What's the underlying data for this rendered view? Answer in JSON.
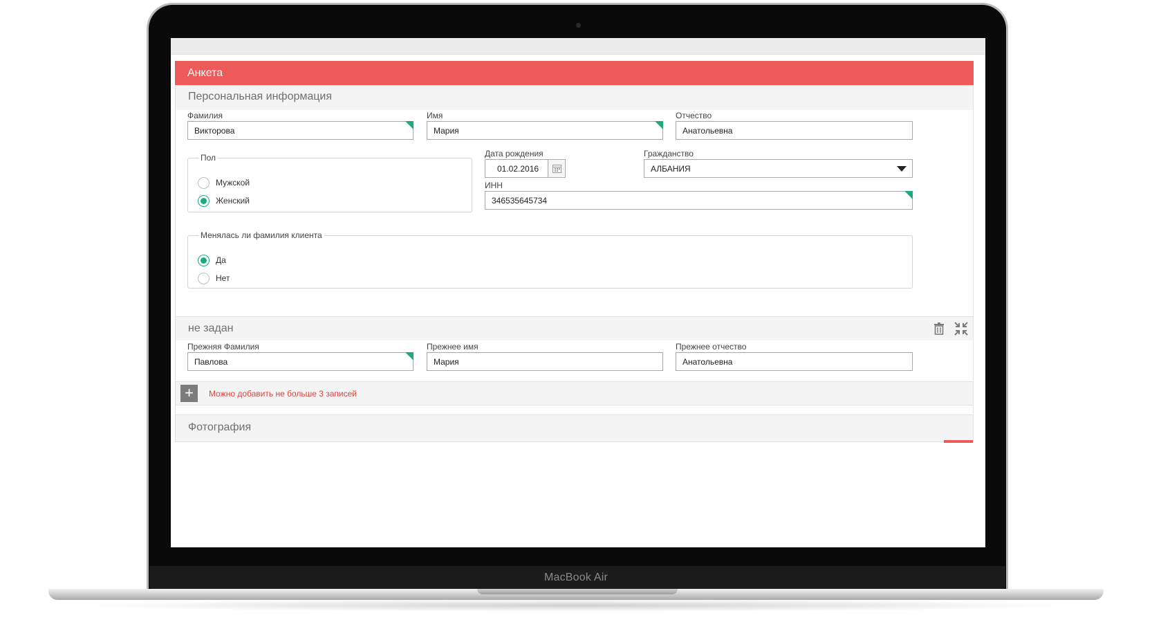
{
  "device": {
    "brand_label": "MacBook Air"
  },
  "form": {
    "header_title": "Анкета",
    "personal_section": {
      "title": "Персональная информация",
      "last_name": {
        "label": "Фамилия",
        "value": "Викторова"
      },
      "first_name": {
        "label": "Имя",
        "value": "Мария"
      },
      "patronymic": {
        "label": "Отчество",
        "value": "Анатольевна"
      },
      "gender": {
        "legend": "Пол",
        "options": [
          {
            "label": "Мужской",
            "checked": false
          },
          {
            "label": "Женский",
            "checked": true
          }
        ]
      },
      "birth_date": {
        "label": "Дата рождения",
        "value": "01.02.2016"
      },
      "citizenship": {
        "label": "Гражданство",
        "value": "АЛБАНИЯ"
      },
      "inn": {
        "label": "ИНН",
        "value": "346535645734"
      },
      "name_changed": {
        "legend": "Менялась ли фамилия клиента",
        "options": [
          {
            "label": "Да",
            "checked": true
          },
          {
            "label": "Нет",
            "checked": false
          }
        ]
      }
    },
    "previous_name_section": {
      "title": "не задан",
      "prev_last_name": {
        "label": "Прежняя Фамилия",
        "value": "Павлова"
      },
      "prev_first_name": {
        "label": "Прежнее имя",
        "value": "Мария"
      },
      "prev_patronymic": {
        "label": "Прежнее отчество",
        "value": "Анатольевна"
      },
      "add_note": "Можно добавить не больше 3 записей",
      "add_button_glyph": "+"
    },
    "photo_section": {
      "title": "Фотография"
    }
  },
  "colors": {
    "header": "#ec5a5a",
    "accent": "#1faa7e",
    "warning_text": "#d9453f"
  }
}
